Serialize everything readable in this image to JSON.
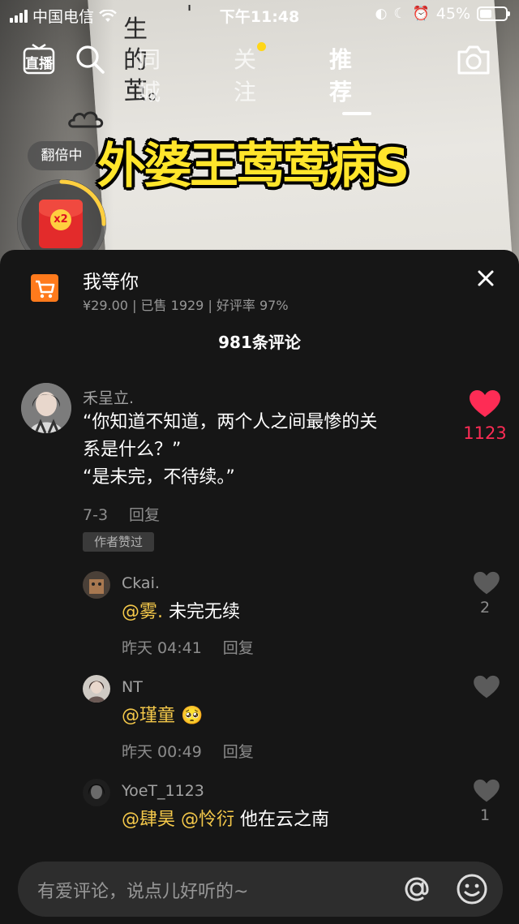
{
  "status_bar": {
    "carrier": "中国电信",
    "time": "下午11:48",
    "battery": "45%",
    "battery_level": 0.45
  },
  "top_nav": {
    "live_label": "直播",
    "tabs": [
      {
        "label": "同城",
        "active": false,
        "dot": false
      },
      {
        "label": "关注",
        "active": false,
        "dot": true
      },
      {
        "label": "推荐",
        "active": true,
        "dot": false
      }
    ]
  },
  "video": {
    "overlay_title": "外婆王莺莺病S",
    "handwriting": "生的茧。"
  },
  "reward": {
    "label": "翻倍中",
    "multiplier": "x2",
    "progress": 0.25
  },
  "product": {
    "title": "我等你",
    "meta": "¥29.00 | 已售 1929 | 好评率 97%"
  },
  "comments_header": {
    "count_label": "981条评论"
  },
  "comments": [
    {
      "user": "禾呈立.",
      "lines": [
        "“你知道不知道，两个人之间最惨的关",
        "系是什么？”",
        "“是未完，不待续。”"
      ],
      "date": "7-3",
      "reply": "回复",
      "badge": "作者赞过",
      "likes": "1123",
      "liked": true
    }
  ],
  "replies": [
    {
      "user": "Ckai.",
      "mention": "@雾.",
      "text": " 未完无续",
      "date": "昨天 04:41",
      "reply": "回复",
      "likes": "2"
    },
    {
      "user": "NT",
      "mention": "@瑾童",
      "text": " 🥺",
      "date": "昨天 00:49",
      "reply": "回复",
      "likes": ""
    },
    {
      "user": "YoeT_1123",
      "mention": "@肆昊 @怜衍",
      "text": " 他在云之南",
      "date": "",
      "reply": "",
      "likes": "1"
    }
  ],
  "input": {
    "placeholder": "有爱评论，说点儿好听的~"
  },
  "colors": {
    "accent_like": "#fe2c55",
    "mention": "#f4c84a",
    "overlay_title": "#ffe52b",
    "cart": "#ff7a1c",
    "panel": "#161616"
  }
}
